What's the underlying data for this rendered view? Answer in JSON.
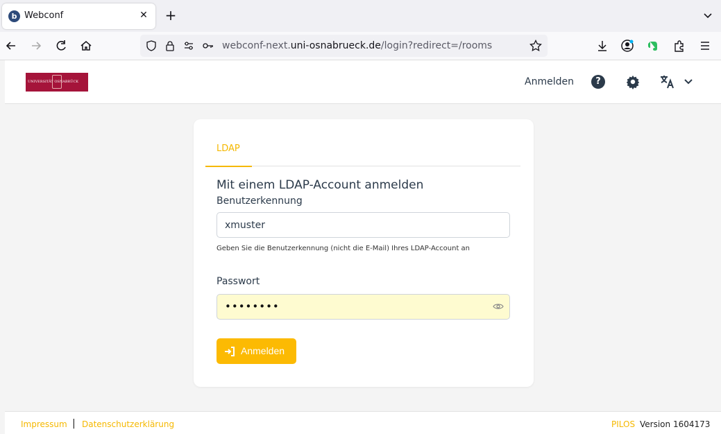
{
  "browser": {
    "tab_title": "Webconf",
    "tab_favicon": "b",
    "url_host_prefix": "webconf-next.",
    "url_host": "uni-osnabrueck.de",
    "url_path": "/login?redirect=/rooms"
  },
  "header": {
    "logo_text": "UNIVERSITÄT OSNABRÜCK",
    "login_label": "Anmelden"
  },
  "card": {
    "tab_label": "LDAP",
    "title": "Mit einem LDAP-Account anmelden",
    "username_label": "Benutzerkennung",
    "username_value": "xmuster",
    "username_help": "Geben Sie die Benutzerkennung (nicht die E-Mail) Ihres LDAP-Account an",
    "password_label": "Passwort",
    "password_masked": "••••••••",
    "submit_label": "Anmelden"
  },
  "footer": {
    "impressum": "Impressum",
    "separator": "|",
    "datenschutz": "Datenschutzerklärung",
    "brand": "PILOS",
    "version": "Version 1604173"
  },
  "colors": {
    "accent": "#fcba03",
    "link": "#f5b800",
    "logo_bg": "#a5143a",
    "autofill_bg": "#fefbd0"
  }
}
